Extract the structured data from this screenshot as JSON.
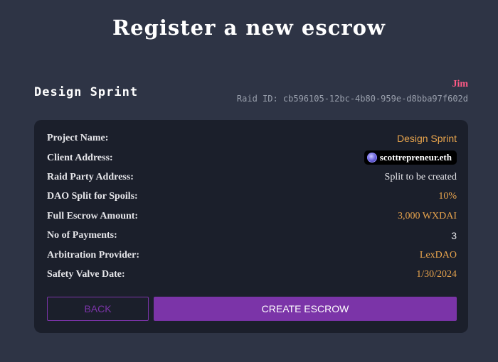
{
  "page": {
    "title": "Register a new escrow"
  },
  "raid": {
    "name": "Design Sprint",
    "client_name": "Jim",
    "raid_id_label": "Raid ID: cb596105-12bc-4b80-959e-d8bba97f602d"
  },
  "details": [
    {
      "label": "Project Name:",
      "value": "Design Sprint"
    },
    {
      "label": "Client Address:",
      "value": "scottrepreneur.eth"
    },
    {
      "label": "Raid Party Address:",
      "value": "Split to be created"
    },
    {
      "label": "DAO Split for Spoils:",
      "value": "10%"
    },
    {
      "label": "Full Escrow Amount:",
      "value": "3,000 WXDAI"
    },
    {
      "label": "No of Payments:",
      "value": "3"
    },
    {
      "label": "Arbitration Provider:",
      "value": "LexDAO"
    },
    {
      "label": "Safety Valve Date:",
      "value": "1/30/2024"
    }
  ],
  "buttons": {
    "back_label": "BACK",
    "create_label": "CREATE ESCROW"
  },
  "colors": {
    "background": "#2e3445",
    "card": "#1b1f2b",
    "accent_purple": "#7b34a8",
    "value_orange": "#e8a44d",
    "client_pink": "#ff5a86"
  },
  "icons": {
    "client_avatar": "ens-avatar-icon"
  }
}
